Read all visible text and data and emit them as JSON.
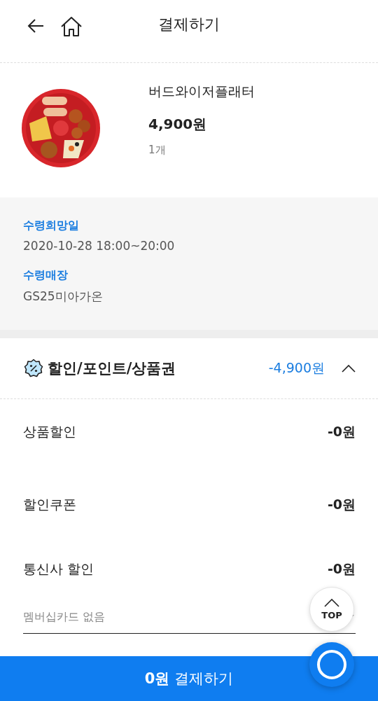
{
  "header": {
    "title": "결제하기"
  },
  "product": {
    "name": "버드와이저플래터",
    "price": "4,900원",
    "quantity": "1개"
  },
  "pickup": [
    {
      "label": "수령희망일",
      "value": "2020-10-28 18:00~20:00"
    },
    {
      "label": "수령매장",
      "value": "GS25미아가온"
    }
  ],
  "discount": {
    "title": "할인/포인트/상품권",
    "total": "-4,900원",
    "expanded": true,
    "rows": [
      {
        "label": "상품할인",
        "amount": "-0원"
      },
      {
        "label": "할인쿠폰",
        "amount": "-0원"
      },
      {
        "label": "통신사 할인",
        "amount": "-0원"
      }
    ],
    "membership": {
      "value": "멤버십카드 없음"
    }
  },
  "top_button": {
    "label": "TOP"
  },
  "pay_button": {
    "label": "**0원** 결제하기"
  }
}
